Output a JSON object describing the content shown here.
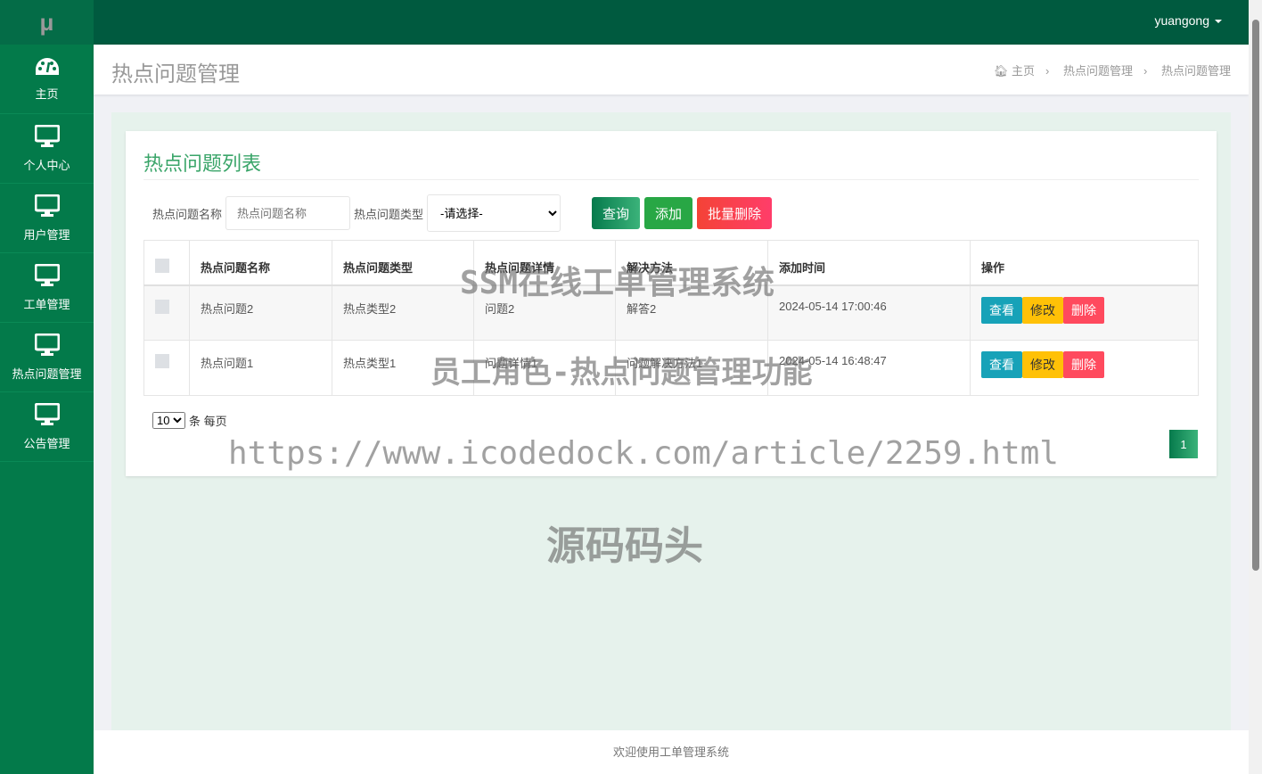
{
  "logo": "μ",
  "sidebar": {
    "items": [
      {
        "label": "主页",
        "icon": "dashboard-icon"
      },
      {
        "label": "个人中心",
        "icon": "monitor-icon"
      },
      {
        "label": "用户管理",
        "icon": "monitor-icon"
      },
      {
        "label": "工单管理",
        "icon": "monitor-icon"
      },
      {
        "label": "热点问题管理",
        "icon": "monitor-icon"
      },
      {
        "label": "公告管理",
        "icon": "monitor-icon"
      }
    ]
  },
  "topbar": {
    "user": "yuangong"
  },
  "header": {
    "title": "热点问题管理",
    "breadcrumb": [
      "主页",
      "热点问题管理",
      "热点问题管理"
    ]
  },
  "panel": {
    "title": "热点问题列表",
    "filters": {
      "name_label": "热点问题名称",
      "name_placeholder": "热点问题名称",
      "type_label": "热点问题类型",
      "type_value": "-请选择-"
    },
    "buttons": {
      "query": "查询",
      "add": "添加",
      "batch_delete": "批量删除"
    },
    "table": {
      "columns": [
        "热点问题名称",
        "热点问题类型",
        "热点问题详情",
        "解决方法",
        "添加时间",
        "操作"
      ],
      "rows": [
        [
          "热点问题2",
          "热点类型2",
          "问题2",
          "解答2",
          "2024-05-14 17:00:46"
        ],
        [
          "热点问题1",
          "热点类型1",
          "问题详情1",
          "问题解决方法1",
          "2024-05-14 16:48:47"
        ]
      ],
      "actions": {
        "view": "查看",
        "edit": "修改",
        "delete": "删除"
      }
    },
    "pager": {
      "page_size": "10",
      "per_page_label": "条 每页",
      "current_page": "1"
    }
  },
  "footer": "欢迎使用工单管理系统",
  "watermarks": [
    "SSM在线工单管理系统",
    "员工角色-热点问题管理功能",
    "https://www.icodedock.com/article/2259.html",
    "源码码头"
  ],
  "colors": {
    "sidebar": "#037a4a",
    "topbar": "#005a3f",
    "accent": "#3aa569"
  }
}
